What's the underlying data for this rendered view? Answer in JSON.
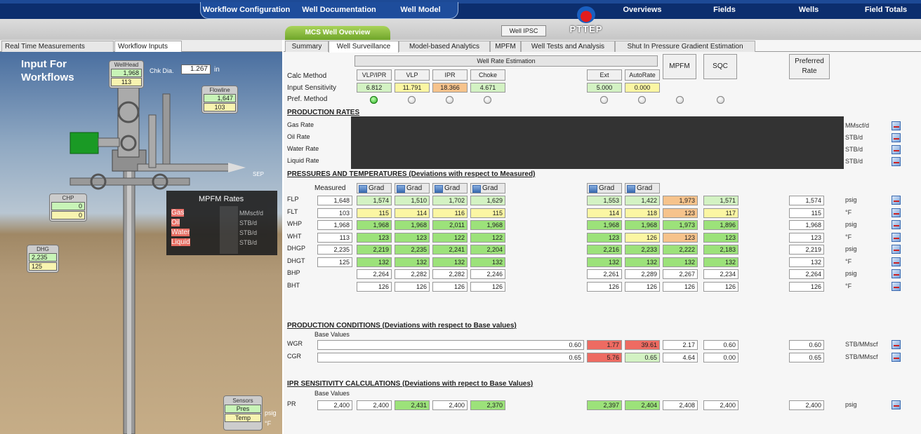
{
  "nav": {
    "workflow_configuration": "Workflow Configuration",
    "well_documentation": "Well Documentation",
    "well_model": "Well Model",
    "overviews": "Overviews",
    "fields": "Fields",
    "wells": "Wells",
    "field_totals": "Field Totals"
  },
  "logo": {
    "text": "PTTEP"
  },
  "subnav": {
    "mcs_well_overview": "MCS Well Overview",
    "well_ipsc": "Well IPSC"
  },
  "left_tabs": [
    "Real Time Measurements",
    "Workflow Inputs"
  ],
  "scene": {
    "title_line1": "Input For",
    "title_line2": "Workflows",
    "wellhead_label": "WellHead",
    "wellhead_pres": "1,968",
    "wellhead_temp": "113",
    "chk_dia_label": "Chk Dia.",
    "chk_dia_value": "1.267",
    "chk_dia_unit": "in",
    "flowline_label": "Flowline",
    "flowline_pres": "1,647",
    "flowline_temp": "103",
    "sep_label": "SEP",
    "chp_label": "CHP",
    "chp_val1": "0",
    "chp_val2": "0",
    "dhg_label": "DHG",
    "dhg_pres": "2,235",
    "dhg_temp": "125",
    "mpfm_title": "MPFM Rates",
    "mpfm_rows": [
      {
        "name": "Gas",
        "unit": "MMscf/d"
      },
      {
        "name": "Oil",
        "unit": "STB/d"
      },
      {
        "name": "Water",
        "unit": "STB/d"
      },
      {
        "name": "Liquid",
        "unit": "STB/d"
      }
    ],
    "sensors_label": "Sensors",
    "sensors_pres": "Pres",
    "sensors_pres_unit": "psig",
    "sensors_temp": "Temp",
    "sensors_temp_unit": "°F"
  },
  "tabs": [
    "Summary",
    "Well Surveillance",
    "Model-based Analytics",
    "MPFM",
    "Well Tests and Analysis",
    "Shut In Pressure Gradient Estimation"
  ],
  "active_tab": "Well Surveillance",
  "rate_est": {
    "title": "Well Rate Estimation",
    "calc_method_label": "Calc Method",
    "input_sens_label": "Input Sensitivity",
    "pref_method_label": "Pref. Method",
    "methods": [
      "VLP/IPR",
      "VLP",
      "IPR",
      "Choke",
      "Ext",
      "AutoRate"
    ],
    "sensitivity": [
      "6.812",
      "11.791",
      "18.366",
      "4.671",
      "5.000",
      "0.000"
    ],
    "mpfm_btn": "MPFM",
    "sqc_btn": "SQC",
    "preferred_rate_btn": "Preferred Rate"
  },
  "production_rates": {
    "title": "PRODUCTION RATES",
    "rows": [
      {
        "label": "Gas Rate",
        "unit": "MMscf/d"
      },
      {
        "label": "Oil Rate",
        "unit": "STB/d"
      },
      {
        "label": "Water Rate",
        "unit": "STB/d"
      },
      {
        "label": "Liquid Rate",
        "unit": "STB/d"
      }
    ]
  },
  "pressures": {
    "title": "PRESSURES AND TEMPERATURES  (Deviations with respect to Measured)",
    "measured_label": "Measured",
    "grad_label": "Grad",
    "rows": [
      {
        "label": "FLP",
        "measured": "1,648",
        "vals": [
          "1,574",
          "1,510",
          "1,702",
          "1,629",
          "1,553",
          "1,422",
          "1,973",
          "1,571"
        ],
        "pref": "1,574",
        "unit": "psig"
      },
      {
        "label": "FLT",
        "measured": "103",
        "vals": [
          "115",
          "114",
          "116",
          "115",
          "114",
          "118",
          "123",
          "117"
        ],
        "pref": "115",
        "unit": "°F"
      },
      {
        "label": "WHP",
        "measured": "1,968",
        "vals": [
          "1,968",
          "1,968",
          "2,011",
          "1,968",
          "1,968",
          "1,968",
          "1,973",
          "1,896"
        ],
        "pref": "1,968",
        "unit": "psig"
      },
      {
        "label": "WHT",
        "measured": "113",
        "vals": [
          "123",
          "123",
          "122",
          "122",
          "123",
          "126",
          "123",
          "123"
        ],
        "pref": "123",
        "unit": "°F"
      },
      {
        "label": "DHGP",
        "measured": "2,235",
        "vals": [
          "2,219",
          "2,235",
          "2,241",
          "2,204",
          "2,216",
          "2,233",
          "2,222",
          "2,183"
        ],
        "pref": "2,219",
        "unit": "psig"
      },
      {
        "label": "DHGT",
        "measured": "125",
        "vals": [
          "132",
          "132",
          "132",
          "132",
          "132",
          "132",
          "132",
          "132"
        ],
        "pref": "132",
        "unit": "°F"
      },
      {
        "label": "BHP",
        "measured": "",
        "vals": [
          "2,264",
          "2,282",
          "2,282",
          "2,246",
          "2,261",
          "2,289",
          "2,267",
          "2,234"
        ],
        "pref": "2,264",
        "unit": "psig"
      },
      {
        "label": "BHT",
        "measured": "",
        "vals": [
          "126",
          "126",
          "126",
          "126",
          "126",
          "126",
          "126",
          "126"
        ],
        "pref": "126",
        "unit": "°F"
      }
    ]
  },
  "production_conditions": {
    "title": "PRODUCTION CONDITIONS  (Deviations with respect to Base values)",
    "base_label": "Base Values",
    "rows": [
      {
        "label": "WGR",
        "base": "0.60",
        "vals": [
          "1.77",
          "39.61",
          "2.17",
          "0.60"
        ],
        "pref": "0.60",
        "unit": "STB/MMscf"
      },
      {
        "label": "CGR",
        "base": "0.65",
        "vals": [
          "5.76",
          "0.65",
          "4.64",
          "0.00"
        ],
        "pref": "0.65",
        "unit": "STB/MMscf"
      }
    ]
  },
  "ipr_sensitivity": {
    "title": "IPR SENSITIVITY CALCULATIONS  (Deviations with repect to Base Values)",
    "base_label": "Base Values",
    "row": {
      "label": "PR",
      "base": "2,400",
      "vals": [
        "2,400",
        "2,431",
        "2,400",
        "2,370",
        "2,397",
        "2,404",
        "2,408",
        "2,400"
      ],
      "pref": "2,400",
      "unit": "psig"
    }
  },
  "colors": {
    "nav_bg": "#0c2e6e",
    "green_cell": "#9ce27a",
    "yellow_cell": "#fbf6a3",
    "orange_cell": "#f6c38c",
    "red_cell": "#ee6b62"
  }
}
